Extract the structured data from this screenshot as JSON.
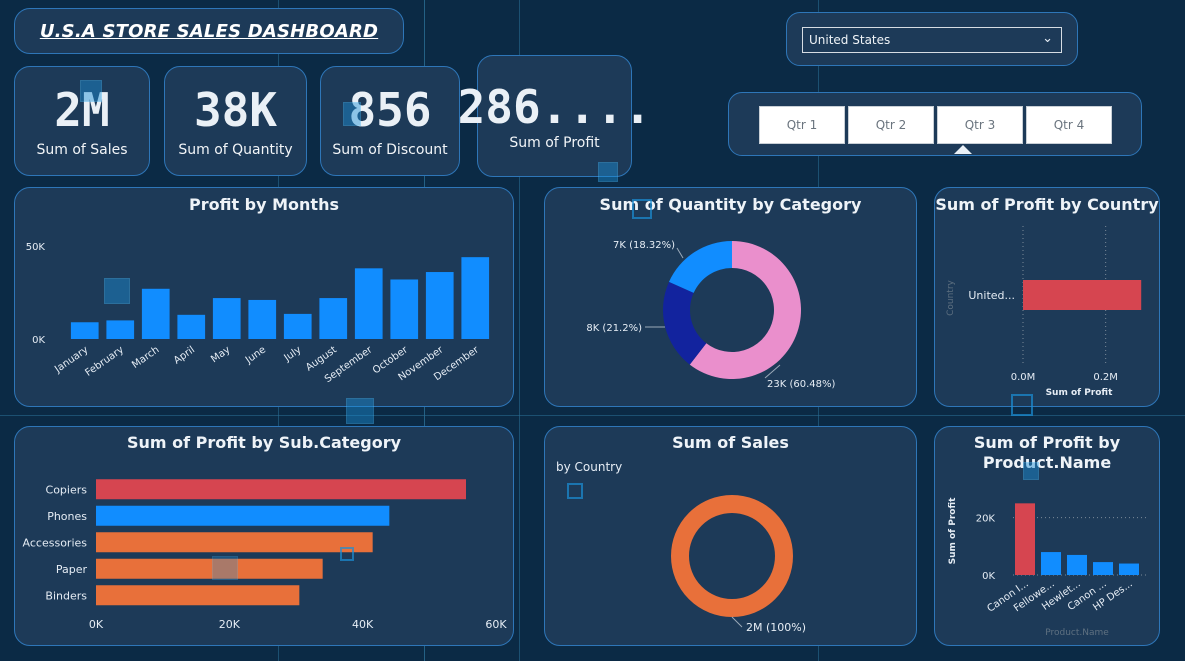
{
  "dashboard": {
    "title": "U.S.A STORE SALES DASHBOARD"
  },
  "filters": {
    "country_selected": "United States",
    "quarters": [
      "Qtr 1",
      "Qtr 2",
      "Qtr 3",
      "Qtr 4"
    ],
    "selected_quarter": "Qtr 3"
  },
  "kpis": [
    {
      "value": "2M",
      "label": "Sum of Sales"
    },
    {
      "value": "38K",
      "label": "Sum of Quantity"
    },
    {
      "value": "856",
      "label": "Sum of Discount"
    },
    {
      "value": "286....",
      "label": "Sum of Profit"
    }
  ],
  "colors": {
    "bar_blue": "#118dff",
    "bar_red": "#d64550",
    "bar_orange": "#e8703a",
    "pink": "#ea8fcc",
    "navy": "#12239e"
  },
  "chart_data": [
    {
      "type": "bar",
      "title": "Profit by Months",
      "categories": [
        "January",
        "February",
        "March",
        "April",
        "May",
        "June",
        "July",
        "August",
        "September",
        "October",
        "November",
        "December"
      ],
      "values": [
        9000,
        10000,
        27000,
        13000,
        22000,
        21000,
        13500,
        22000,
        38000,
        32000,
        36000,
        44000
      ],
      "yticks": [
        "0K",
        "50K"
      ],
      "ylim": [
        0,
        50000
      ]
    },
    {
      "type": "pie",
      "title": "Sum of Quantity by Category",
      "slices": [
        {
          "label": "23K (60.48%)",
          "value": 60.48,
          "color": "#ea8fcc"
        },
        {
          "label": "8K (21.2%)",
          "value": 21.2,
          "color": "#12239e"
        },
        {
          "label": "7K (18.32%)",
          "value": 18.32,
          "color": "#118dff"
        }
      ]
    },
    {
      "type": "bar",
      "title": "Sum of Profit by Country",
      "categories": [
        "United..."
      ],
      "values": [
        286000
      ],
      "xticks": [
        "0.0M",
        "0.2M"
      ],
      "xlabel": "Sum of Profit",
      "ylabel": "Country",
      "xlim": [
        0,
        0.3
      ]
    },
    {
      "type": "bar",
      "title": "Sum of Profit by Sub.Category",
      "categories": [
        "Copiers",
        "Phones",
        "Accessories",
        "Paper",
        "Binders"
      ],
      "values": [
        55500,
        44000,
        41500,
        34000,
        30500
      ],
      "colors": [
        "#d64550",
        "#118dff",
        "#e8703a",
        "#e8703a",
        "#e8703a"
      ],
      "xticks": [
        "0K",
        "20K",
        "40K",
        "60K"
      ],
      "xlim": [
        0,
        60000
      ]
    },
    {
      "type": "pie",
      "title": "Sum of Sales",
      "subtitle": "by Country",
      "slices": [
        {
          "label": "2M (100%)",
          "value": 100,
          "color": "#e8703a"
        }
      ]
    },
    {
      "type": "bar",
      "title": "Sum of Profit by Product.Name",
      "categories": [
        "Canon I...",
        "Fellowe...",
        "Hewlet...",
        "Canon ...",
        "HP Des..."
      ],
      "values": [
        25000,
        8000,
        7000,
        4500,
        4000
      ],
      "colors": [
        "#d64550",
        "#118dff",
        "#118dff",
        "#118dff",
        "#118dff"
      ],
      "yticks": [
        "0K",
        "20K"
      ],
      "ylabel": "Sum of Profit",
      "xlabel": "Product.Name",
      "ylim": [
        0,
        30000
      ]
    }
  ]
}
